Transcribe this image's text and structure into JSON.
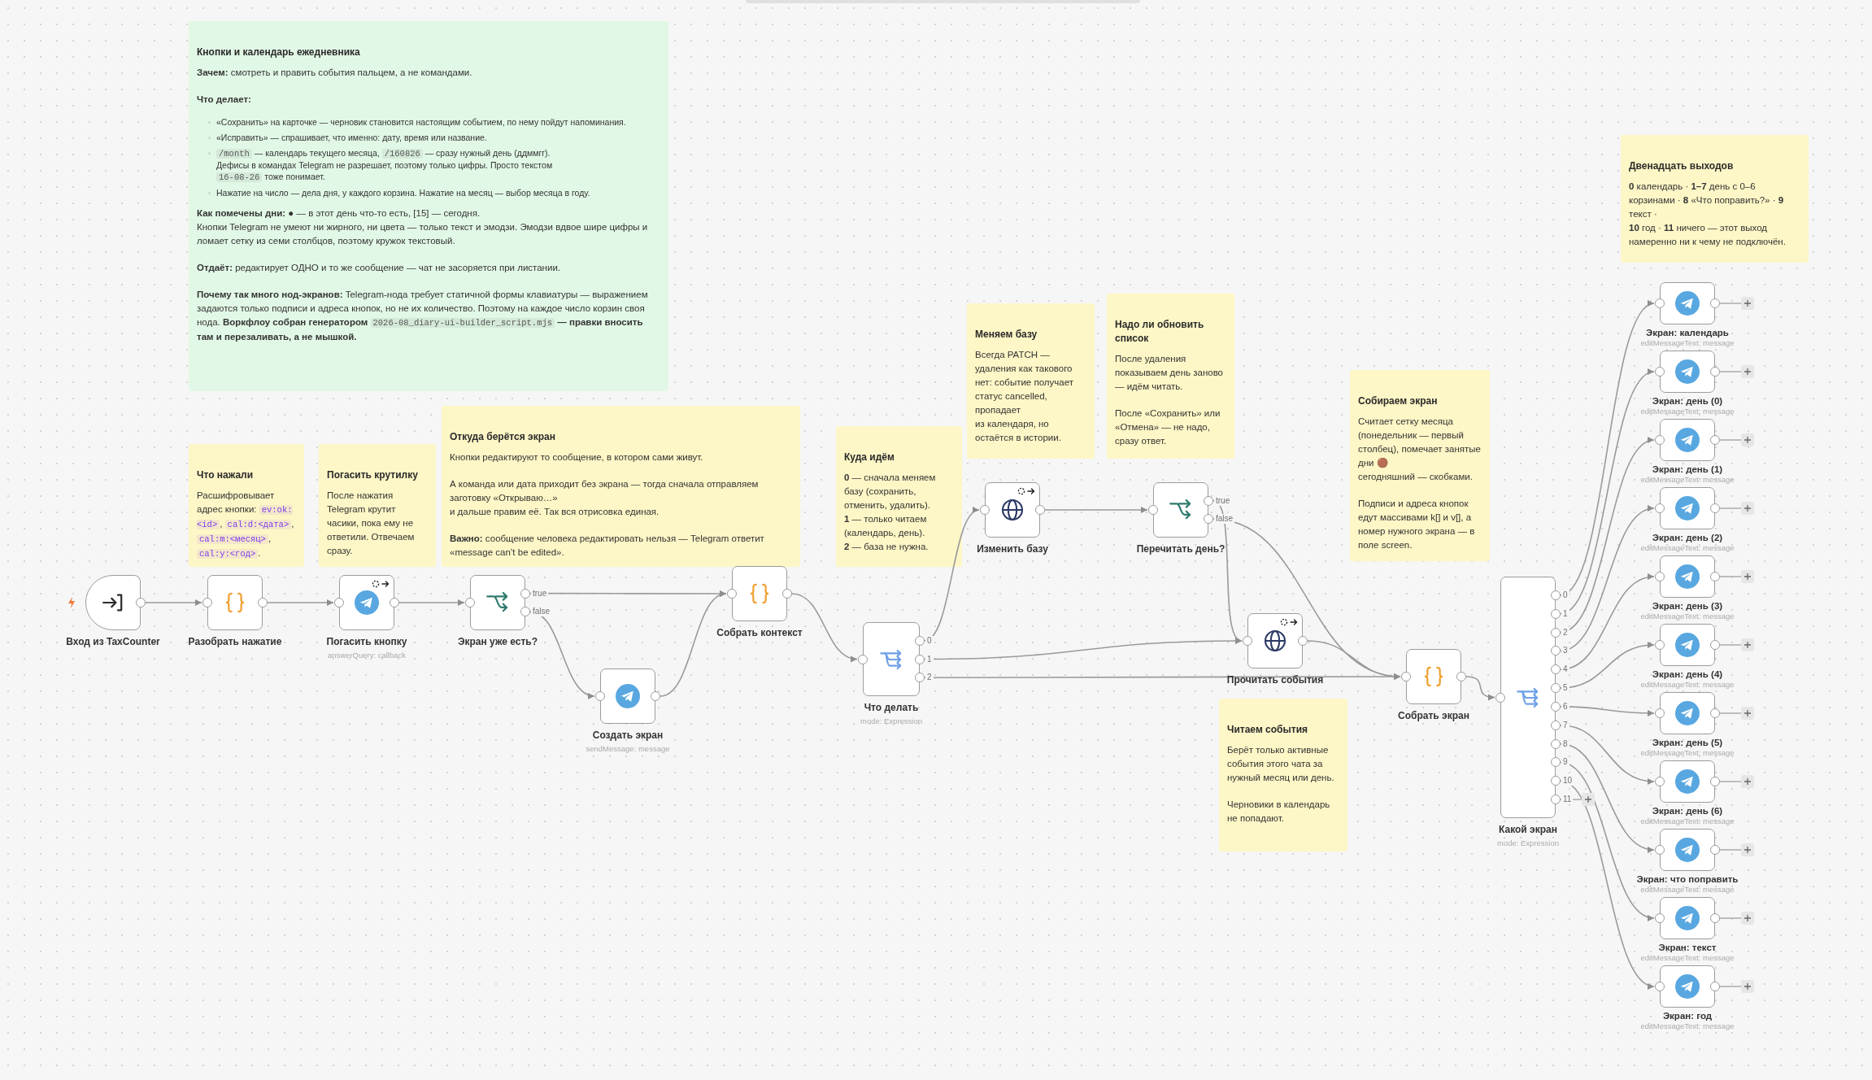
{
  "notes": [
    {
      "color": "#e2f8e6",
      "title": "Кнопки и календарь ежедневника",
      "blocks": [
        {
          "kind": "p",
          "text": "**Зачем:** смотреть и править события пальцем, а не командами."
        },
        {
          "kind": "heading",
          "text": "Что делает:"
        },
        {
          "kind": "list",
          "items": [
            "«Сохранить» на карточке — черновик становится настоящим событием, по нему пойдут напоминания.",
            "«Исправить» — спрашивает, что именно: дату, время или название.",
            [
              {
                "code": "/month"
              },
              " — календарь текущего месяца, ",
              {
                "code": "/160826"
              },
              " — сразу нужный день (ддммгг).\nДефисы в командах Telegram не разрешает, поэтому только цифры. Просто текстом\n",
              {
                "code": "16-08-26"
              },
              " тоже понимает."
            ],
            "Нажатие на число — дела дня, у каждого корзина. Нажатие на месяц — выбор месяца в году."
          ]
        },
        {
          "kind": "p",
          "text": "**Как помечены дни:** ● — в этот день что-то есть, [15] — сегодня.\nКнопки Telegram не умеют ни жирного, ни цвета — только текст и эмодзи. Эмодзи вдвое шире цифры и ломает сетку из семи столбцов, поэтому кружок текстовый."
        },
        {
          "kind": "p",
          "text": "**Отдаёт:** редактирует ОДНО и то же сообщение — чат не засоряется при листании."
        },
        {
          "kind": "p",
          "text": [
            "**Почему так много нод-экранов:** Telegram-нода требует статичной формы клавиатуры — выражением задаются только подписи и адреса кнопок, но не их количество. Поэтому на каждое число корзин своя нода. **Воркфлоу собран генератором** ",
            {
              "code": "2026-08_diary-ui-builder_script.mjs"
            },
            " **— правки вносить там и перезаливать, а не мышкой.**"
          ]
        }
      ]
    },
    {
      "color": "#fdf6c6",
      "title": "Что нажали",
      "blocks": [
        {
          "kind": "p",
          "text": [
            "Расшифровывает адрес кнопки: ",
            {
              "code": "ev:ok:<id>"
            },
            ", ",
            {
              "code": "cal:d:<дата>"
            },
            ", ",
            {
              "code": "cal:m:<месяц>"
            },
            ", ",
            {
              "code": "cal:y:<год>"
            },
            "."
          ]
        }
      ]
    },
    {
      "color": "#fdf6c6",
      "title": "Погасить крутилку",
      "blocks": [
        {
          "kind": "p",
          "text": "После нажатия Telegram крутит часики, пока ему не ответили. Отвечаем сразу."
        }
      ]
    },
    {
      "color": "#fdf6c6",
      "title": "Откуда берётся экран",
      "blocks": [
        {
          "kind": "p",
          "text": "Кнопки редактируют то сообщение, в котором сами живут."
        },
        {
          "kind": "p",
          "text": "А команда или дата приходит без экрана — тогда сначала отправляем заготовку «Открываю…»\nи дальше правим её. Так вся отрисовка единая."
        },
        {
          "kind": "p",
          "text": "**Важно:** сообщение человека редактировать нельзя — Telegram ответит «message can’t be edited»."
        }
      ]
    },
    {
      "color": "#fdf6c6",
      "title": "Куда идём",
      "blocks": [
        {
          "kind": "p",
          "text": "**0** — сначала меняем базу (сохранить, отменить, удалить).\n**1** — только читаем (календарь, день).\n**2** — база не нужна."
        }
      ]
    },
    {
      "color": "#fdf6c6",
      "title": "Меняем базу",
      "blocks": [
        {
          "kind": "p",
          "text": "Всегда PATCH — удаления как такового нет: событие получает статус cancelled, пропадает\nиз календаря, но остаётся в истории."
        }
      ]
    },
    {
      "color": "#fdf6c6",
      "title": "Надо ли обновить список",
      "blocks": [
        {
          "kind": "p",
          "text": "После удаления показываем день заново — идём читать."
        },
        {
          "kind": "p",
          "text": "После «Сохранить» или «Отмена» — не надо, сразу ответ."
        }
      ]
    },
    {
      "color": "#fdf6c6",
      "title": "Собираем экран",
      "blocks": [
        {
          "kind": "p",
          "text": "Считает сетку месяца (понедельник — первый столбец), помечает занятые дни 🟤\nсегодняшний — скобками."
        },
        {
          "kind": "p",
          "text": "Подписи и адреса кнопок едут массивами k[] и v[], а номер нужного экрана — в поле screen."
        }
      ]
    },
    {
      "color": "#fdf6c6",
      "title": "Читаем события",
      "blocks": [
        {
          "kind": "p",
          "text": "Берёт только активные события этого чата за нужный месяц или день."
        },
        {
          "kind": "p",
          "text": "Черновики в календарь не попадают."
        }
      ]
    },
    {
      "color": "#fdf6c6",
      "title": "Двенадцать выходов",
      "blocks": [
        {
          "kind": "p",
          "text": "**0** календарь · **1–7** день с 0–6 корзинами · **8** «Что поправить?» · **9** текст ·\n**10** год · **11** ничего — этот выход намеренно ни к чему не подключён."
        }
      ]
    }
  ],
  "nodes": [
    {
      "label": "Вход из TaxCounter",
      "kind": "trigger"
    },
    {
      "label": "Разобрать нажатие",
      "kind": "code"
    },
    {
      "label": "Погасить кнопку",
      "subtitle": "answerQuery: callback",
      "kind": "telegram",
      "toolbar": true
    },
    {
      "label": "Экран уже есть?",
      "kind": "if",
      "outputs": [
        {
          "label": "true",
          "connected": true
        },
        {
          "label": "false",
          "connected": true
        }
      ]
    },
    {
      "label": "Создать экран",
      "subtitle": "sendMessage: message",
      "kind": "telegram"
    },
    {
      "label": "Собрать контекст",
      "kind": "code"
    },
    {
      "label": "Что делать",
      "subtitle": "mode: Expression",
      "kind": "switch",
      "outputs": [
        {
          "label": "0",
          "connected": true
        },
        {
          "label": "1",
          "connected": true
        },
        {
          "label": "2",
          "connected": true
        }
      ]
    },
    {
      "label": "Изменить базу",
      "kind": "http",
      "toolbar": true
    },
    {
      "label": "Перечитать день?",
      "kind": "if",
      "outputs": [
        {
          "label": "true",
          "connected": true
        },
        {
          "label": "false",
          "connected": true
        }
      ]
    },
    {
      "label": "Прочитать события",
      "kind": "http",
      "toolbar": true
    },
    {
      "label": "Собрать экран",
      "kind": "code"
    },
    {
      "label": "Какой экран",
      "subtitle": "mode: Expression",
      "kind": "switch",
      "outputs": [
        {
          "label": "0",
          "connected": true
        },
        {
          "label": "1",
          "connected": true
        },
        {
          "label": "2",
          "connected": true
        },
        {
          "label": "3",
          "connected": true
        },
        {
          "label": "4",
          "connected": true
        },
        {
          "label": "5",
          "connected": true
        },
        {
          "label": "6",
          "connected": true
        },
        {
          "label": "7",
          "connected": true
        },
        {
          "label": "8",
          "connected": true
        },
        {
          "label": "9",
          "connected": true
        },
        {
          "label": "10",
          "connected": true
        },
        {
          "label": "11",
          "connected": false
        }
      ]
    },
    {
      "label": "Экран: календарь",
      "subtitle": "editMessageText: message",
      "kind": "telegram",
      "outputs": [
        {
          "connected": false
        }
      ]
    },
    {
      "label": "Экран: день (0)",
      "subtitle": "editMessageText: message",
      "kind": "telegram",
      "outputs": [
        {
          "connected": false
        }
      ]
    },
    {
      "label": "Экран: день (1)",
      "subtitle": "editMessageText: message",
      "kind": "telegram",
      "outputs": [
        {
          "connected": false
        }
      ]
    },
    {
      "label": "Экран: день (2)",
      "subtitle": "editMessageText: message",
      "kind": "telegram",
      "outputs": [
        {
          "connected": false
        }
      ]
    },
    {
      "label": "Экран: день (3)",
      "subtitle": "editMessageText: message",
      "kind": "telegram",
      "outputs": [
        {
          "connected": false
        }
      ]
    },
    {
      "label": "Экран: день (4)",
      "subtitle": "editMessageText: message",
      "kind": "telegram",
      "outputs": [
        {
          "connected": false
        }
      ]
    },
    {
      "label": "Экран: день (5)",
      "subtitle": "editMessageText: message",
      "kind": "telegram",
      "outputs": [
        {
          "connected": false
        }
      ]
    },
    {
      "label": "Экран: день (6)",
      "subtitle": "editMessageText: message",
      "kind": "telegram",
      "outputs": [
        {
          "connected": false
        }
      ]
    },
    {
      "label": "Экран: что поправить",
      "subtitle": "editMessageText: message",
      "kind": "telegram",
      "outputs": [
        {
          "connected": false
        }
      ]
    },
    {
      "label": "Экран: текст",
      "subtitle": "editMessageText: message",
      "kind": "telegram",
      "outputs": [
        {
          "connected": false
        }
      ]
    },
    {
      "label": "Экран: год",
      "subtitle": "editMessageText: message",
      "kind": "telegram",
      "outputs": [
        {
          "connected": false
        }
      ]
    }
  ]
}
